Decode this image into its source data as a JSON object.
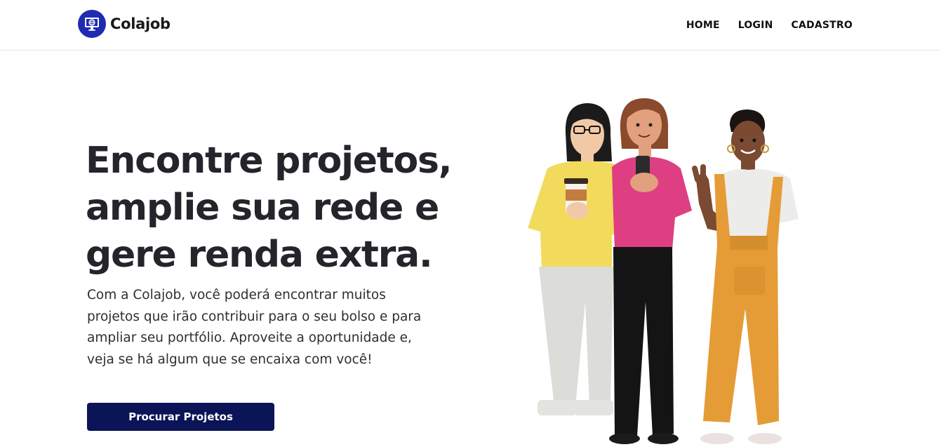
{
  "header": {
    "brand_name": "Colajob",
    "logo_icon": "monitor-globe-icon",
    "nav": [
      {
        "label": "HOME"
      },
      {
        "label": "LOGIN"
      },
      {
        "label": "CADASTRO"
      }
    ]
  },
  "hero": {
    "title_lines": [
      "Encontre projetos,",
      "amplie sua rede e",
      "gere renda extra."
    ],
    "description_lines": [
      "Com a Colajob, você poderá encontrar muitos",
      "projetos que irão contribuir para o seu bolso e para",
      "ampliar seu portfólio. Aproveite a oportunidade e,",
      "veja se há algum que se encaixa com você!"
    ],
    "cta_label": "Procurar Projetos",
    "illustration": "three-people-illustration"
  },
  "colors": {
    "brand": "#1f2bb0",
    "cta_bg": "#0b1457",
    "title": "#24252b"
  }
}
